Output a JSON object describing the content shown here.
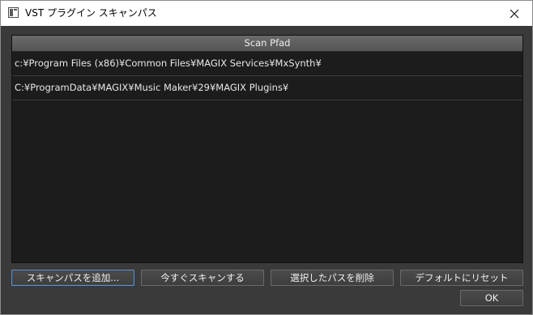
{
  "window": {
    "title": "VST プラグイン スキャンパス"
  },
  "list": {
    "column_header": "Scan Pfad",
    "rows": [
      "c:¥Program Files (x86)¥Common Files¥MAGIX Services¥MxSynth¥",
      "C:¥ProgramData¥MAGIX¥Music Maker¥29¥MAGIX Plugins¥"
    ]
  },
  "buttons": {
    "add_scan_path": "スキャンパスを追加...",
    "scan_now": "今すぐスキャンする",
    "remove_selected": "選択したパスを削除",
    "reset_default": "デフォルトにリセット",
    "ok": "OK"
  },
  "colors": {
    "background": "#3a3a3a",
    "list_background": "#1c1c1c",
    "header_background": "#5f5f5f",
    "text": "#e8e8e8"
  },
  "icons": {
    "app": "window-icon",
    "close": "close-icon"
  }
}
